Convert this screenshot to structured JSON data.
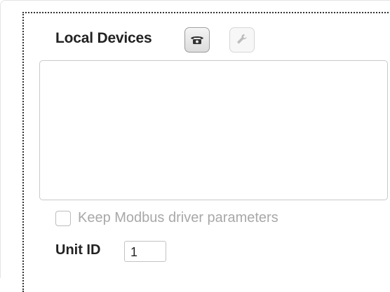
{
  "header": {
    "title": "Local Devices",
    "phone_icon": "phone-icon",
    "tool_icon": "wrench-icon"
  },
  "device_list": {
    "items": []
  },
  "options": {
    "keep_modbus_label": "Keep Modbus driver parameters",
    "keep_modbus_checked": false
  },
  "unit": {
    "label": "Unit ID",
    "value": "1"
  },
  "colors": {
    "dotted_border": "#333333",
    "disabled_text": "#a8a8a8",
    "panel_border": "#c9c9c9"
  }
}
